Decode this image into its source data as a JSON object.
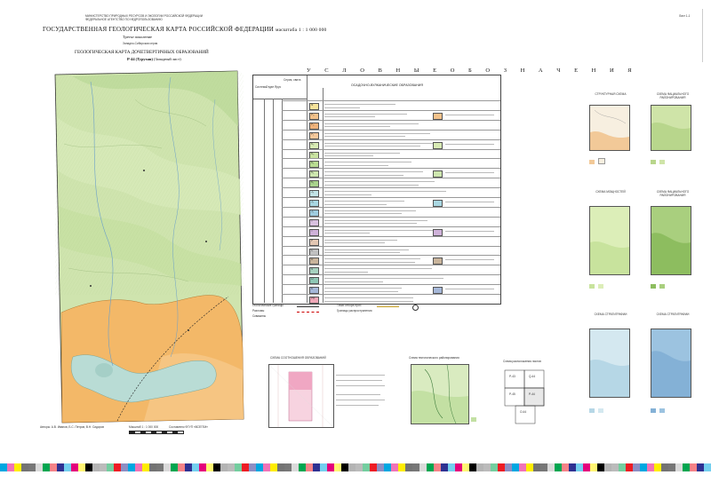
{
  "header": {
    "ministry": "МИНИСТЕРСТВО ПРИРОДНЫХ РЕСУРСОВ И ЭКОЛОГИИ РОССИЙСКОЙ ФЕДЕРАЦИИ",
    "agency": "ФЕДЕРАЛЬНОЕ АГЕНТСТВО ПО НЕДРОПОЛЬЗОВАНИЮ",
    "title": "ГОСУДАРСТВЕННАЯ ГЕОЛОГИЧЕСКАЯ КАРТА РОССИЙСКОЙ ФЕДЕРАЦИИ",
    "scale": "масштаба 1 : 1 000 000",
    "edition": "Третье поколение",
    "series": "Западно-Сибирская серия",
    "map_title": "ГЕОЛОГИЧЕСКАЯ КАРТА ДОЧЕТВЕРТИЧНЫХ ОБРАЗОВАНИЙ",
    "sheet": "Р-44 (Турухан)",
    "sheet_note": "(Западный лист)",
    "sheet_number": "Лист 1-1"
  },
  "legend": {
    "title": "У С Л О В Н Ы Е    О Б О З Н А Ч Е Н И Я",
    "subtitle": "ОСАДОЧНО-ВУЛКАНИЧЕСКИЕ ОБРАЗОВАНИЯ",
    "col_headers": [
      "Система",
      "Отдел",
      "Ярус",
      "Серия, свита",
      "Индекс"
    ],
    "units": [
      {
        "index": "N",
        "color": "#f6e39a"
      },
      {
        "index": "P₃",
        "color": "#f3c28b"
      },
      {
        "index": "P₂",
        "color": "#f0b37b"
      },
      {
        "index": "P₁",
        "color": "#f5c89b"
      },
      {
        "index": "K₂",
        "color": "#d8ebb4"
      },
      {
        "index": "K₂",
        "color": "#c9e3a0"
      },
      {
        "index": "K₁",
        "color": "#b9dc92"
      },
      {
        "index": "K₁",
        "color": "#cde6ae"
      },
      {
        "index": "K₁",
        "color": "#a9d38c"
      },
      {
        "index": "J₃",
        "color": "#c2e3e6"
      },
      {
        "index": "J₂",
        "color": "#a9d7e2"
      },
      {
        "index": "J₁",
        "color": "#9fcde0"
      },
      {
        "index": "T",
        "color": "#d9c2e0"
      },
      {
        "index": "T",
        "color": "#cfb2d9"
      },
      {
        "index": "P",
        "color": "#e3c7b3"
      },
      {
        "index": "C",
        "color": "#c1c1c1"
      },
      {
        "index": "D",
        "color": "#c9b49b"
      },
      {
        "index": "S",
        "color": "#a7d2c0"
      },
      {
        "index": "O",
        "color": "#8fc7b5"
      },
      {
        "index": "Є",
        "color": "#a5b7d8"
      },
      {
        "index": "PR",
        "color": "#f0a7b7"
      }
    ],
    "symbols_title": "Геологические границы",
    "symbols": [
      "Геологические границы",
      "Разломы",
      "Скважины",
      "Точки отбора проб",
      "Границы распространения"
    ]
  },
  "insets": {
    "left_title": "СХЕМА СООТНОШЕНИЯ ОБРАЗОВАНИЙ",
    "mid_title": "Схема тектонического районирования",
    "right_title": "Схема расположения листов",
    "right_labels": [
      "P-43",
      "P-44",
      "P-45",
      "Q-44",
      "O-44"
    ],
    "panel_titles": [
      "СТРУКТУРНАЯ СХЕМА",
      "СХЕМА ФАЦИАЛЬНОГО РАЙОНИРОВАНИЯ",
      "СХЕМА МОЩНОСТЕЙ",
      "СХЕМА ФАЦИАЛЬНОГО РАЙОНИРОВАНИЯ",
      "СХЕМА СТРАТИГРАФИИ",
      "СХЕМА СТРАТИГРАФИИ"
    ]
  },
  "footer": {
    "editors": "Авторы: А.В. Иванов, Б.С. Петров, В.Н. Сидоров",
    "scale_label": "Масштаб 1 : 1 000 000",
    "credits": "Составлено ФГУП «ВСЕГЕИ»"
  },
  "colors": {
    "map_green": "#c8e0a6",
    "map_orange": "#f3b868",
    "map_blue": "#b9dcd5",
    "frame": "#444444"
  },
  "color_bar": [
    "#00a7e1",
    "#e4007c",
    "#ffed00",
    "#000000",
    "#777777",
    "#bbbbbb",
    "#00a650",
    "#ed1c24",
    "#2e3192"
  ]
}
